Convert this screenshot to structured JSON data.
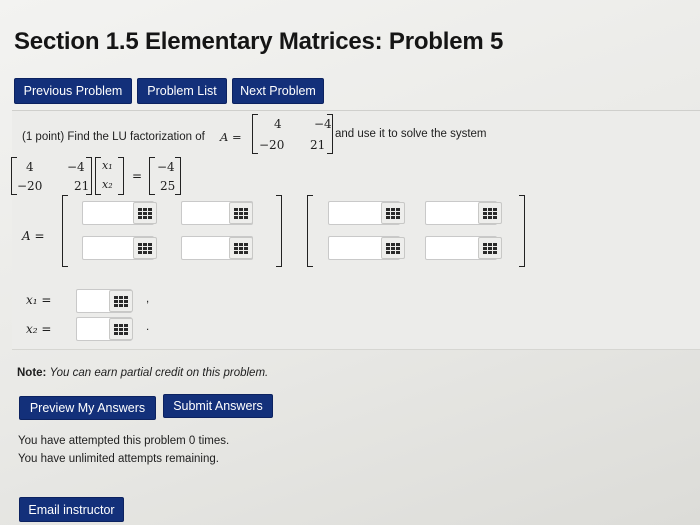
{
  "title": "Section 1.5 Elementary Matrices: Problem 5",
  "nav": {
    "previous": "Previous Problem",
    "list": "Problem List",
    "next": "Next Problem"
  },
  "problem": {
    "intro": "(1 point) Find the LU factorization of",
    "a_label": "A =",
    "suffix": "and use it to solve the system",
    "matrix_A": {
      "a11": "4",
      "a12": "−4",
      "a21": "−20",
      "a22": "21"
    },
    "system": {
      "x1": "x₁",
      "x2": "x₂",
      "eq": "=",
      "b1": "−4",
      "b2": "25"
    },
    "lu_label": "A =",
    "x1_label": "x₁ =",
    "x2_label": "x₂ =",
    "comma": ",",
    "period": "."
  },
  "note": {
    "label": "Note:",
    "text": "You can earn partial credit on this problem."
  },
  "buttons": {
    "preview": "Preview My Answers",
    "submit": "Submit Answers",
    "email": "Email instructor"
  },
  "status": {
    "attempts": "You have attempted this problem 0 times.",
    "remaining": "You have unlimited attempts remaining."
  },
  "colors": {
    "button": "#13307a",
    "background": "#ececea"
  }
}
